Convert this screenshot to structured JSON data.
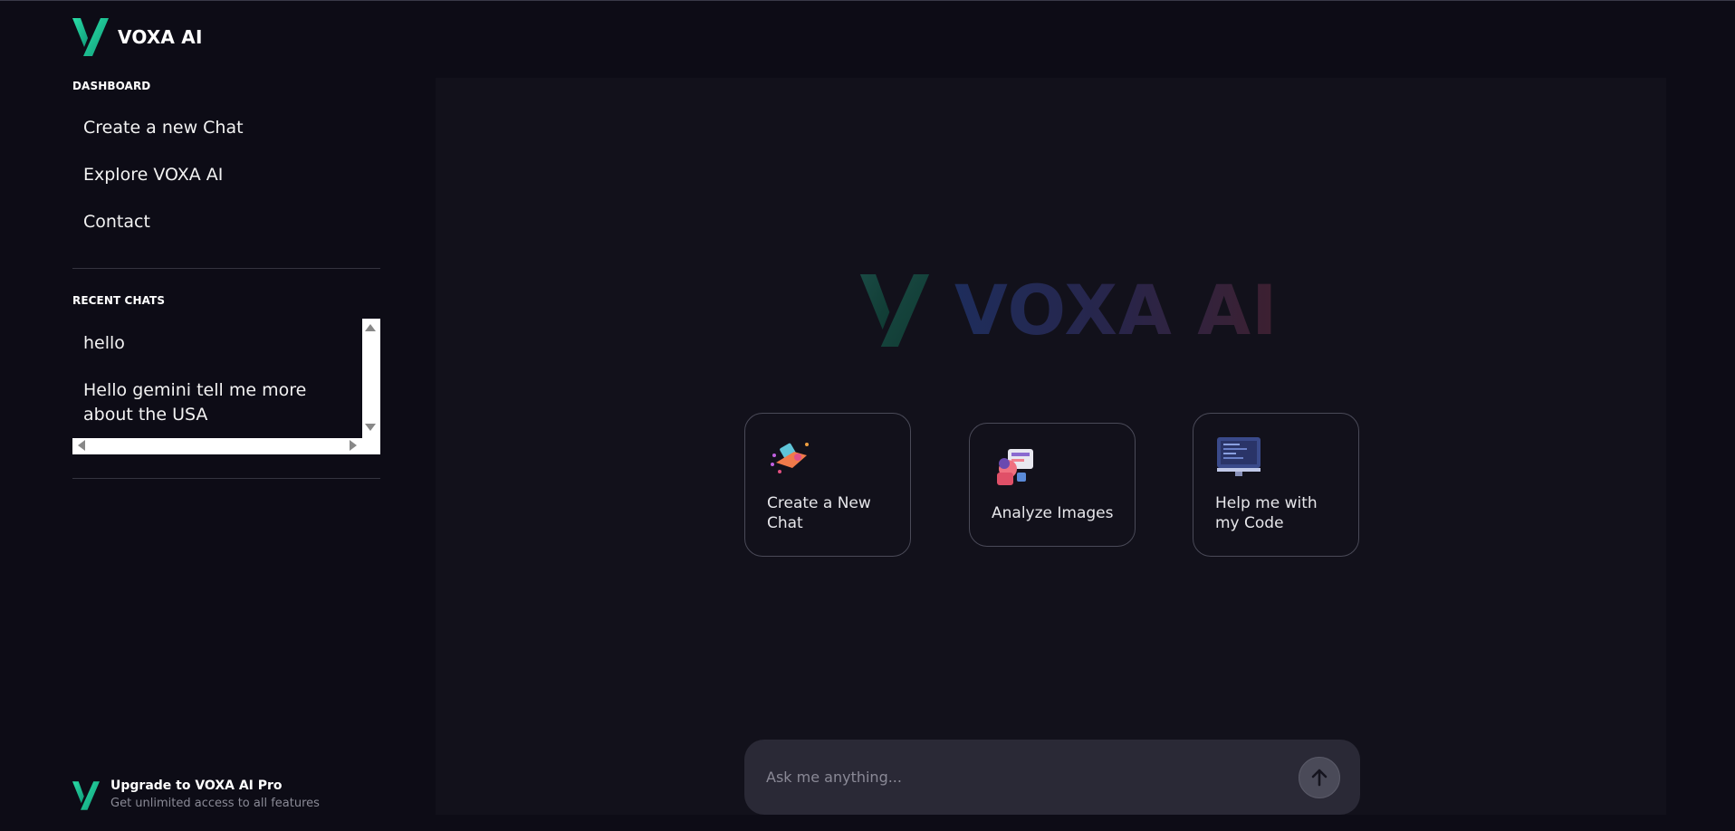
{
  "app": {
    "name": "VOXA AI",
    "brand_colors": {
      "green": "#1fc89a",
      "blue": "#1e2d5c",
      "purple": "#28254a",
      "red": "#3d2030"
    }
  },
  "sidebar": {
    "dashboard_label": "DASHBOARD",
    "nav_items": [
      {
        "label": "Create a new Chat"
      },
      {
        "label": "Explore VOXA AI"
      },
      {
        "label": "Contact"
      }
    ],
    "recent_label": "RECENT CHATS",
    "recent_chats": [
      {
        "label": "hello"
      },
      {
        "label": "Hello gemini tell me more about the USA"
      }
    ],
    "upgrade": {
      "title": "Upgrade to VOXA AI Pro",
      "subtitle": "Get unlimited access to all features"
    }
  },
  "main": {
    "hero_text": "VOXA AI",
    "cards": [
      {
        "label": "Create a New Chat",
        "icon": "rocket-phone-icon"
      },
      {
        "label": "Analyze Images",
        "icon": "image-analysis-icon"
      },
      {
        "label": "Help me with my Code",
        "icon": "code-monitor-icon"
      }
    ],
    "input": {
      "placeholder": "Ask me anything...",
      "value": ""
    },
    "send_icon": "arrow-up-icon"
  }
}
